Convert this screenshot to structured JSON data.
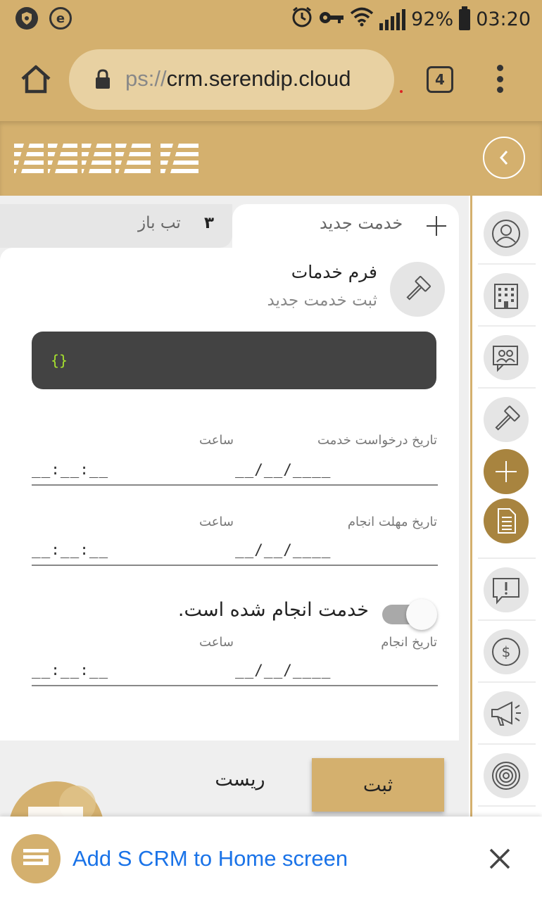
{
  "status_bar": {
    "battery_percent": "92%",
    "time": "03:20",
    "left_icons": [
      "vpn-shield-icon",
      "e-app-icon"
    ],
    "right_icons": [
      "alarm-icon",
      "key-icon",
      "wifi-icon",
      "signal-icon",
      "battery-icon"
    ]
  },
  "browser": {
    "url_scheme": "ps://",
    "url_host": "crm.serendip.cloud",
    "tab_count": "4"
  },
  "app": {
    "tabs": {
      "open_count": "۳",
      "open_label": "تب باز",
      "new_label": "خدمت جدید"
    },
    "form": {
      "title": "فرم خدمات",
      "subtitle": "ثبت خدمت جدید",
      "json_preview": "{}"
    },
    "fields": {
      "request_date_label": "تاریخ درخواست خدمت",
      "request_time_label": "ساعت",
      "request_date_value": "__/__/____",
      "request_time_value": "__:__:__",
      "deadline_date_label": "تاریخ مهلت انجام",
      "deadline_time_label": "ساعت",
      "deadline_date_value": "__/__/____",
      "deadline_time_value": "__:__:__",
      "done_toggle_label": "خدمت انجام شده است.",
      "done_toggle_on": false,
      "done_date_label": "تاریخ انجام",
      "done_time_label": "ساعت",
      "done_date_value": "__/__/____",
      "done_time_value": "__:__:__"
    },
    "actions": {
      "submit_label": "ثبت",
      "reset_label": "ریست"
    },
    "sidebar_items": [
      "contacts-icon",
      "organizations-icon",
      "meetings-icon",
      "services-icon",
      "add-icon",
      "documents-icon",
      "feedback-icon",
      "payments-icon",
      "campaigns-icon",
      "target-icon"
    ]
  },
  "banner": {
    "text": "Add S CRM to Home screen"
  },
  "colors": {
    "brand_gold": "#d4b06e",
    "dark_gold": "#a8843f",
    "link_blue": "#1a73e8",
    "json_bg": "#434343",
    "json_text": "#a6e22e"
  }
}
